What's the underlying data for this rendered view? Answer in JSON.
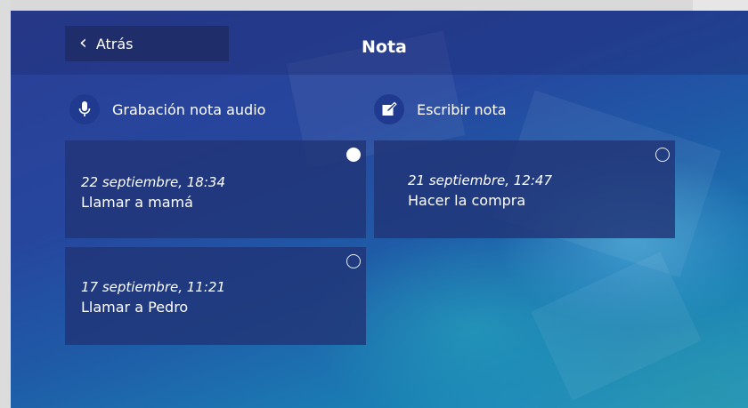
{
  "header": {
    "back_label": "Atrás",
    "title": "Nota"
  },
  "actions": {
    "record": {
      "label": "Grabación nota audio",
      "icon": "microphone-icon"
    },
    "write": {
      "label": "Escribir nota",
      "icon": "write-note-icon"
    }
  },
  "notes": [
    {
      "date": "22 septiembre, 18:34",
      "text": "Llamar a mamá",
      "selected": true
    },
    {
      "date": "21 septiembre, 12:47",
      "text": "Hacer la compra",
      "selected": false
    },
    {
      "date": "17 septiembre, 11:21",
      "text": "Llamar a Pedro",
      "selected": false
    }
  ],
  "colors": {
    "card": "#213476",
    "back_button": "#1f2e6a",
    "icon_circle": "#1f3a8e"
  }
}
